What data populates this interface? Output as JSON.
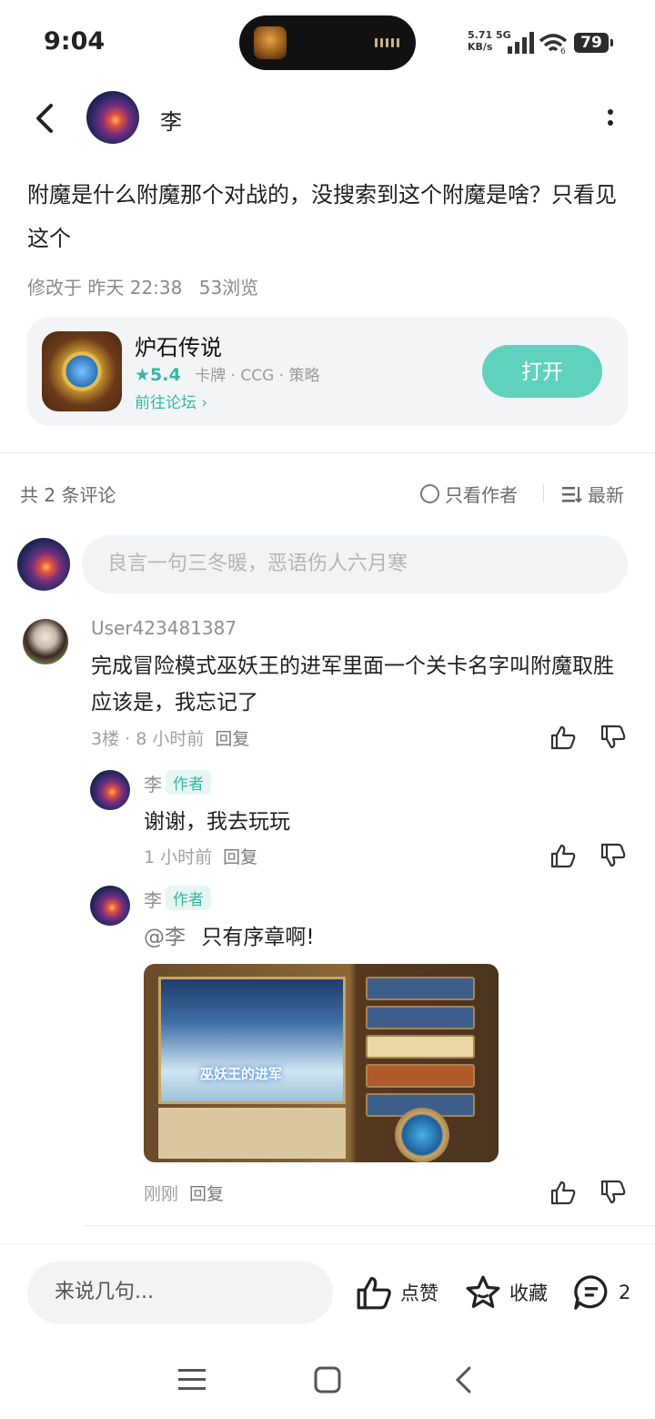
{
  "status_bar": {
    "time": "9:04",
    "net_speed": "5.71",
    "net_unit": "KB/s",
    "net_type": "5G",
    "wifi_level": "6",
    "battery": "79"
  },
  "header": {
    "author_name": "李"
  },
  "post": {
    "text": "附魔是什么附魔那个对战的，没搜索到这个附魔是啥？只看见这个",
    "modified": "修改于 昨天 22:38",
    "views": "53浏览"
  },
  "app_card": {
    "name": "炉石传说",
    "rating": "5.4",
    "tags": "卡牌 · CCG · 策略",
    "forum_link": "前往论坛",
    "open_label": "打开"
  },
  "comments_header": {
    "count_label": "共 2 条评论",
    "only_author": "只看作者",
    "sort": "最新"
  },
  "comment_input": {
    "placeholder": "良言一句三冬暖，恶语伤人六月寒"
  },
  "comments": [
    {
      "user": "User423481387",
      "text": "完成冒险模式巫妖王的进军里面一个关卡名字叫附魔取胜应该是，我忘记了",
      "meta": "3楼 · 8 小时前",
      "reply": "回复"
    }
  ],
  "replies": [
    {
      "user": "李",
      "badge": "作者",
      "text": "谢谢，我去玩玩",
      "meta": "1 小时前",
      "reply": "回复"
    },
    {
      "user": "李",
      "badge": "作者",
      "mention": "@李",
      "text": "只有序章啊!",
      "image_title": "巫妖王的进军",
      "meta": "刚刚",
      "reply": "回复"
    }
  ],
  "bottom_bar": {
    "input_placeholder": "来说几句...",
    "like_label": "点赞",
    "fav_label": "收藏",
    "comment_count": "2"
  },
  "colors": {
    "accent": "#5fd1bd",
    "accent_text": "#35b8a2"
  }
}
